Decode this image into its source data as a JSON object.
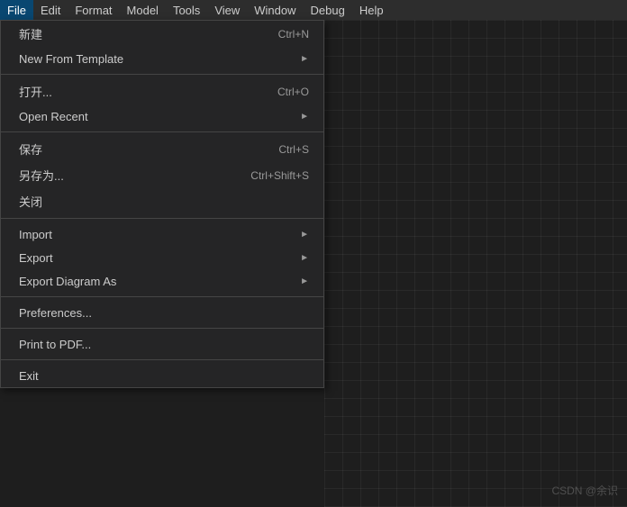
{
  "menubar": {
    "items": [
      {
        "id": "file",
        "label": "File",
        "active": true
      },
      {
        "id": "edit",
        "label": "Edit",
        "active": false
      },
      {
        "id": "format",
        "label": "Format",
        "active": false
      },
      {
        "id": "model",
        "label": "Model",
        "active": false
      },
      {
        "id": "tools",
        "label": "Tools",
        "active": false
      },
      {
        "id": "view",
        "label": "View",
        "active": false
      },
      {
        "id": "window",
        "label": "Window",
        "active": false
      },
      {
        "id": "debug",
        "label": "Debug",
        "active": false
      },
      {
        "id": "help",
        "label": "Help",
        "active": false
      }
    ]
  },
  "dropdown": {
    "items": [
      {
        "id": "new",
        "label": "新建",
        "shortcut": "Ctrl+N",
        "hasArrow": false,
        "type": "item"
      },
      {
        "id": "new-template",
        "label": "New From Template",
        "shortcut": "",
        "hasArrow": true,
        "type": "item"
      },
      {
        "id": "sep1",
        "type": "separator"
      },
      {
        "id": "open",
        "label": "打开...",
        "shortcut": "Ctrl+O",
        "hasArrow": false,
        "type": "item"
      },
      {
        "id": "open-recent",
        "label": "Open Recent",
        "shortcut": "",
        "hasArrow": true,
        "type": "item"
      },
      {
        "id": "sep2",
        "type": "separator"
      },
      {
        "id": "save",
        "label": "保存",
        "shortcut": "Ctrl+S",
        "hasArrow": false,
        "type": "item"
      },
      {
        "id": "save-as",
        "label": "另存为...",
        "shortcut": "Ctrl+Shift+S",
        "hasArrow": false,
        "type": "item"
      },
      {
        "id": "close",
        "label": "关闭",
        "shortcut": "",
        "hasArrow": false,
        "type": "item"
      },
      {
        "id": "sep3",
        "type": "separator"
      },
      {
        "id": "import",
        "label": "Import",
        "shortcut": "",
        "hasArrow": true,
        "type": "item"
      },
      {
        "id": "export",
        "label": "Export",
        "shortcut": "",
        "hasArrow": true,
        "type": "item"
      },
      {
        "id": "export-diagram-as",
        "label": "Export Diagram As",
        "shortcut": "",
        "hasArrow": true,
        "type": "item"
      },
      {
        "id": "sep4",
        "type": "separator"
      },
      {
        "id": "preferences",
        "label": "Preferences...",
        "shortcut": "",
        "hasArrow": false,
        "type": "item"
      },
      {
        "id": "sep5",
        "type": "separator"
      },
      {
        "id": "print-to-pdf",
        "label": "Print to PDF...",
        "shortcut": "",
        "hasArrow": false,
        "type": "item"
      },
      {
        "id": "sep6",
        "type": "separator"
      },
      {
        "id": "exit",
        "label": "Exit",
        "shortcut": "",
        "hasArrow": false,
        "type": "item"
      }
    ]
  },
  "watermark": {
    "text": "CSDN @余识"
  }
}
